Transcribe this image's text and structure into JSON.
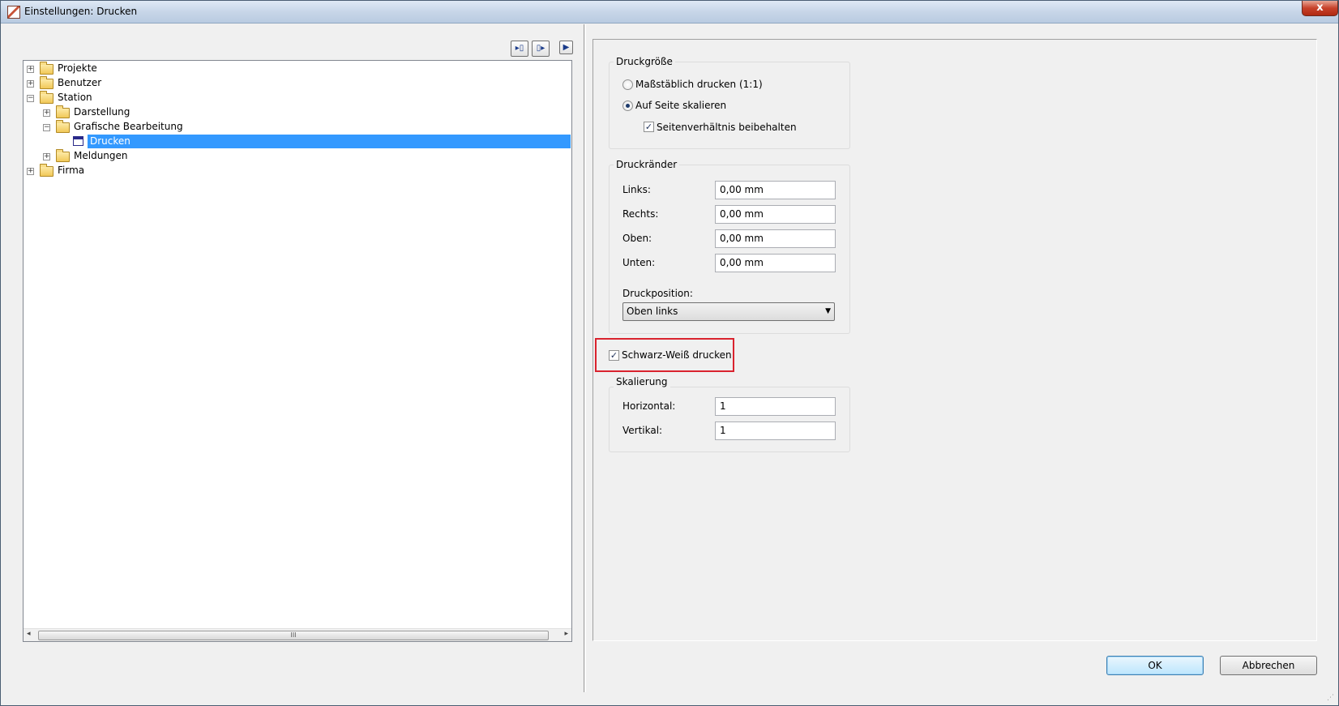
{
  "window": {
    "title": "Einstellungen: Drucken",
    "close_symbol": "x",
    "icons": {
      "app": "settings-app-icon",
      "close": "close-icon"
    }
  },
  "toolbar": {
    "buttons": [
      {
        "name": "collapse-pane-icon"
      },
      {
        "name": "expand-pane-icon"
      },
      {
        "name": "play-icon"
      }
    ]
  },
  "tree": {
    "nodes": [
      {
        "label": "Projekte",
        "level": 0,
        "expander": "+"
      },
      {
        "label": "Benutzer",
        "level": 0,
        "expander": "+"
      },
      {
        "label": "Station",
        "level": 0,
        "expander": "−"
      },
      {
        "label": "Darstellung",
        "level": 1,
        "expander": "+"
      },
      {
        "label": "Grafische Bearbeitung",
        "level": 1,
        "expander": "−"
      },
      {
        "label": "Drucken",
        "level": 2,
        "selected": true
      },
      {
        "label": "Meldungen",
        "level": 1,
        "expander": "+"
      },
      {
        "label": "Firma",
        "level": 0,
        "expander": "+"
      }
    ],
    "scroll_thumb_label": "III",
    "selection_color": "#3399ff"
  },
  "druckgroesse": {
    "title": "Druckgröße",
    "option_1": "Maßstäblich drucken (1:1)",
    "option_2": "Auf Seite skalieren",
    "option_2_selected": true,
    "keep_ratio_label": "Seitenverhältnis beibehalten",
    "keep_ratio_checked": true
  },
  "druckraender": {
    "title": "Druckränder",
    "links_label": "Links:",
    "links_value": "0,00 mm",
    "rechts_label": "Rechts:",
    "rechts_value": "0,00 mm",
    "oben_label": "Oben:",
    "oben_value": "0,00 mm",
    "unten_label": "Unten:",
    "unten_value": "0,00 mm",
    "position_label": "Druckposition:",
    "position_value": "Oben links"
  },
  "schwarz_weiss": {
    "label": "Schwarz-Weiß drucken",
    "checked": true,
    "highlight_color": "#d9232e"
  },
  "skalierung": {
    "title": "Skalierung",
    "horizontal_label": "Horizontal:",
    "horizontal_value": "1",
    "vertikal_label": "Vertikal:",
    "vertikal_value": "1"
  },
  "buttons": {
    "ok": "OK",
    "cancel": "Abbrechen"
  }
}
